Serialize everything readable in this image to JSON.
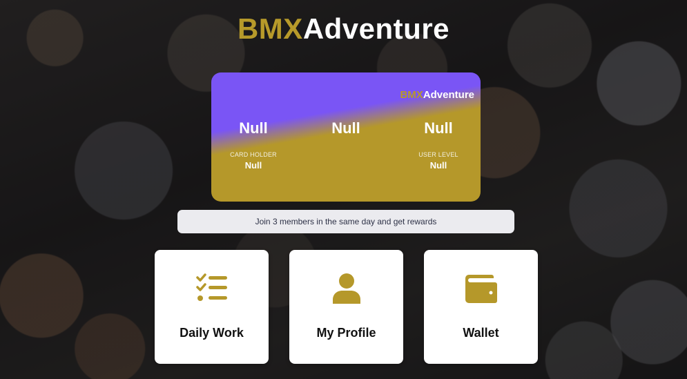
{
  "brand": {
    "part1": "BMX",
    "part2": "Adventure",
    "accent_color": "#b79a2a"
  },
  "card": {
    "brand_part1": "BMX",
    "brand_part2": "Adventure",
    "values": [
      "Null",
      "Null",
      "Null"
    ],
    "card_holder_label": "CARD HOLDER",
    "card_holder_value": "Null",
    "user_level_label": "USER LEVEL",
    "user_level_value": "Null",
    "colors": {
      "top": "#7a55f5",
      "bottom": "#b5982a"
    }
  },
  "banner": {
    "text": "Join 3 members in the same day and get rewards"
  },
  "tiles": [
    {
      "label": "Daily Work",
      "icon": "checklist-icon"
    },
    {
      "label": "My Profile",
      "icon": "user-icon"
    },
    {
      "label": "Wallet",
      "icon": "wallet-icon"
    }
  ]
}
